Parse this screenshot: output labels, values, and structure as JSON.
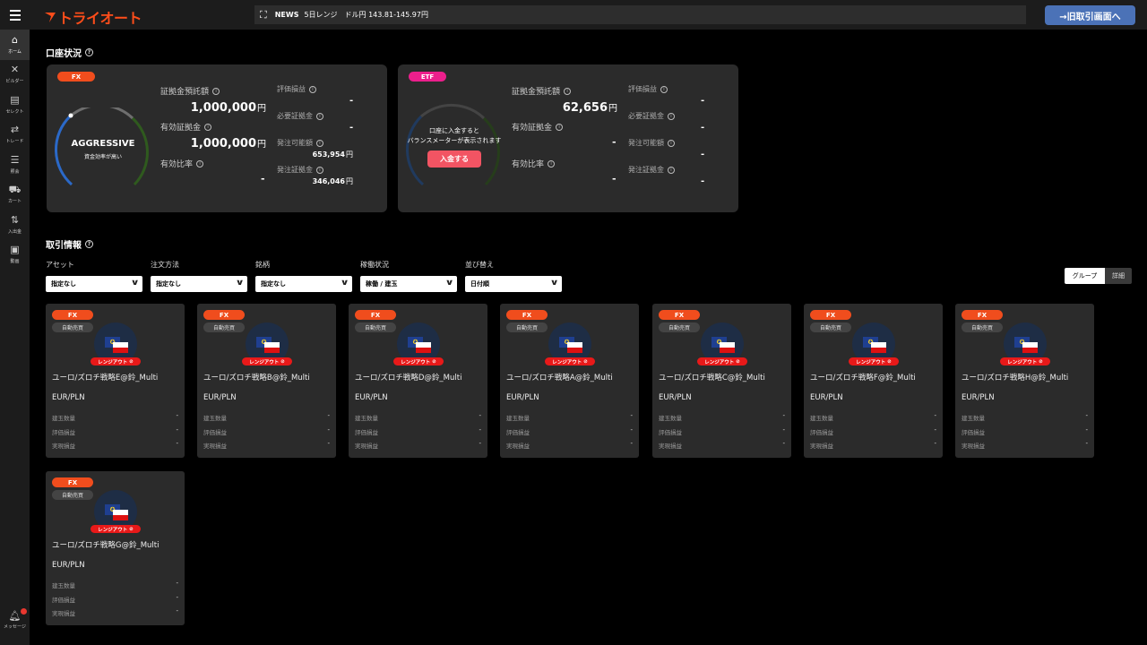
{
  "header": {
    "logo_text": "トライオート",
    "news_label": "NEWS",
    "news_text": "5日レンジ　ドル円 143.81-145.97円",
    "old_screen_button": "→旧取引画面へ"
  },
  "sidebar": {
    "items": [
      {
        "label": "ホーム",
        "icon": "home-icon"
      },
      {
        "label": "ビルダー",
        "icon": "tools-icon"
      },
      {
        "label": "セレクト",
        "icon": "select-icon"
      },
      {
        "label": "トレード",
        "icon": "trade-icon"
      },
      {
        "label": "照会",
        "icon": "list-icon"
      },
      {
        "label": "カート",
        "icon": "cart-icon"
      },
      {
        "label": "入出金",
        "icon": "transfer-icon"
      },
      {
        "label": "動画",
        "icon": "video-icon"
      }
    ],
    "message_label": "メッセージ"
  },
  "account": {
    "title": "口座状況",
    "fx": {
      "tag": "FX",
      "gauge_label": "AGGRESSIVE",
      "gauge_sub": "資金効率が高い",
      "deposit_label": "証拠金預託額",
      "deposit_value": "1,000,000",
      "effective_label": "有効証拠金",
      "effective_value": "1,000,000",
      "ratio_label": "有効比率",
      "ratio_value": "-",
      "unit": "円",
      "pl_label": "評価損益",
      "pl_value": "-",
      "required_label": "必要証拠金",
      "required_value": "-",
      "orderable_label": "発注可能額",
      "orderable_value": "653,954",
      "order_margin_label": "発注証拠金",
      "order_margin_value": "346,046"
    },
    "etf": {
      "tag": "ETF",
      "gauge_msg_1": "口座に入金すると",
      "gauge_msg_2": "バランスメーターが表示されます",
      "deposit_button": "入金する",
      "deposit_label": "証拠金預託額",
      "deposit_value": "62,656",
      "effective_label": "有効証拠金",
      "effective_value": "-",
      "ratio_label": "有効比率",
      "ratio_value": "-",
      "unit": "円",
      "pl_label": "評価損益",
      "pl_value": "-",
      "required_label": "必要証拠金",
      "required_value": "-",
      "orderable_label": "発注可能額",
      "orderable_value": "-",
      "order_margin_label": "発注証拠金",
      "order_margin_value": "-"
    }
  },
  "trading": {
    "title": "取引情報",
    "filters": [
      {
        "label": "アセット",
        "value": "指定なし"
      },
      {
        "label": "注文方法",
        "value": "指定なし"
      },
      {
        "label": "銘柄",
        "value": "指定なし"
      },
      {
        "label": "稼働状況",
        "value": "稼働 / 建玉"
      },
      {
        "label": "並び替え",
        "value": "日付順"
      }
    ],
    "view_group": "グループ",
    "view_detail": "詳細",
    "cards": [
      {
        "tag": "FX",
        "type": "自動売買",
        "badge": "レンジアウト",
        "name": "ユーロ/ズロチ戦略E@鈴_Multi",
        "pair": "EUR/PLN",
        "pos_label": "建玉数量",
        "pos": "-",
        "pl_label": "評価損益",
        "pl": "-",
        "real_label": "実現損益",
        "real": "-"
      },
      {
        "tag": "FX",
        "type": "自動売買",
        "badge": "レンジアウト",
        "name": "ユーロ/ズロチ戦略B@鈴_Multi",
        "pair": "EUR/PLN",
        "pos_label": "建玉数量",
        "pos": "-",
        "pl_label": "評価損益",
        "pl": "-",
        "real_label": "実現損益",
        "real": "-"
      },
      {
        "tag": "FX",
        "type": "自動売買",
        "badge": "レンジアウト",
        "name": "ユーロ/ズロチ戦略D@鈴_Multi",
        "pair": "EUR/PLN",
        "pos_label": "建玉数量",
        "pos": "-",
        "pl_label": "評価損益",
        "pl": "-",
        "real_label": "実現損益",
        "real": "-"
      },
      {
        "tag": "FX",
        "type": "自動売買",
        "badge": "レンジアウト",
        "name": "ユーロ/ズロチ戦略A@鈴_Multi",
        "pair": "EUR/PLN",
        "pos_label": "建玉数量",
        "pos": "-",
        "pl_label": "評価損益",
        "pl": "-",
        "real_label": "実現損益",
        "real": "-"
      },
      {
        "tag": "FX",
        "type": "自動売買",
        "badge": "レンジアウト",
        "name": "ユーロ/ズロチ戦略C@鈴_Multi",
        "pair": "EUR/PLN",
        "pos_label": "建玉数量",
        "pos": "-",
        "pl_label": "評価損益",
        "pl": "-",
        "real_label": "実現損益",
        "real": "-"
      },
      {
        "tag": "FX",
        "type": "自動売買",
        "badge": "レンジアウト",
        "name": "ユーロ/ズロチ戦略F@鈴_Multi",
        "pair": "EUR/PLN",
        "pos_label": "建玉数量",
        "pos": "-",
        "pl_label": "評価損益",
        "pl": "-",
        "real_label": "実現損益",
        "real": "-"
      },
      {
        "tag": "FX",
        "type": "自動売買",
        "badge": "レンジアウト",
        "name": "ユーロ/ズロチ戦略H@鈴_Multi",
        "pair": "EUR/PLN",
        "pos_label": "建玉数量",
        "pos": "-",
        "pl_label": "評価損益",
        "pl": "-",
        "real_label": "実現損益",
        "real": "-"
      },
      {
        "tag": "FX",
        "type": "自動売買",
        "badge": "レンジアウト",
        "name": "ユーロ/ズロチ戦略G@鈴_Multi",
        "pair": "EUR/PLN",
        "pos_label": "建玉数量",
        "pos": "-",
        "pl_label": "評価損益",
        "pl": "-",
        "real_label": "実現損益",
        "real": "-"
      }
    ]
  },
  "colors": {
    "brand": "#ff4d1a",
    "fx_tag": "#f04d1d",
    "etf_tag": "#ec1f8c",
    "range_out": "#e81919",
    "deposit_button": "#f25463",
    "old_screen_button": "#4b72b7"
  }
}
